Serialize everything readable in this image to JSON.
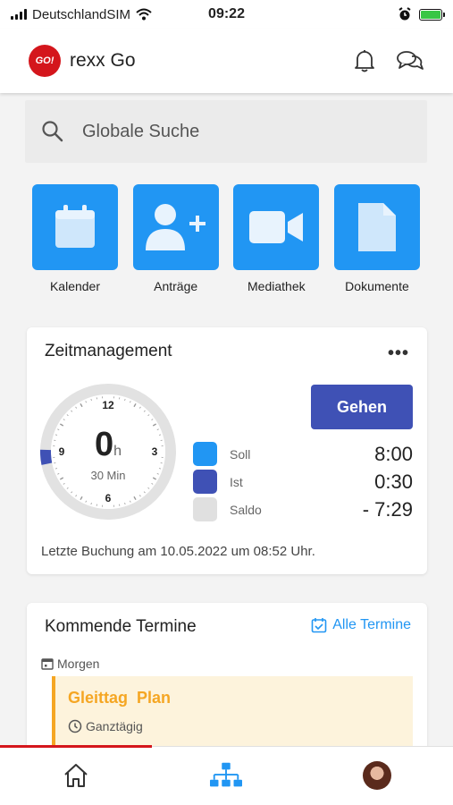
{
  "status_bar": {
    "carrier": "DeutschlandSIM",
    "time": "09:22"
  },
  "header": {
    "logo_text": "GO!",
    "title": "rexx Go"
  },
  "search": {
    "placeholder": "Globale Suche"
  },
  "quick_actions": [
    {
      "label": "Kalender",
      "icon": "calendar-icon"
    },
    {
      "label": "Anträge",
      "icon": "add-user-icon"
    },
    {
      "label": "Mediathek",
      "icon": "video-icon"
    },
    {
      "label": "Dokumente",
      "icon": "document-icon"
    }
  ],
  "zeitmanagement": {
    "title": "Zeitmanagement",
    "more": "•••",
    "clock": {
      "hours": "0",
      "hours_unit": "h",
      "minutes": "30 Min",
      "numbers": [
        "12",
        "3",
        "6",
        "9"
      ],
      "progress_fraction": 0.0625
    },
    "button_label": "Gehen",
    "legend": [
      {
        "name": "Soll",
        "value": "8:00",
        "color": "#2196f3"
      },
      {
        "name": "Ist",
        "value": "0:30",
        "color": "#3f51b5"
      },
      {
        "name": "Saldo",
        "value": "- 7:29",
        "color": "#e0e0e0"
      }
    ],
    "last_booking": "Letzte Buchung am 10.05.2022 um 08:52 Uhr."
  },
  "termine": {
    "title": "Kommende Termine",
    "all_link": "Alle Termine",
    "day_label": "Morgen",
    "event": {
      "title": "Gleittag  Plan",
      "time": "Ganztägig"
    }
  },
  "colors": {
    "accent_blue": "#2196f3",
    "indigo": "#3f51b5",
    "brand_red": "#d4161c",
    "event_orange": "#f5a623"
  }
}
